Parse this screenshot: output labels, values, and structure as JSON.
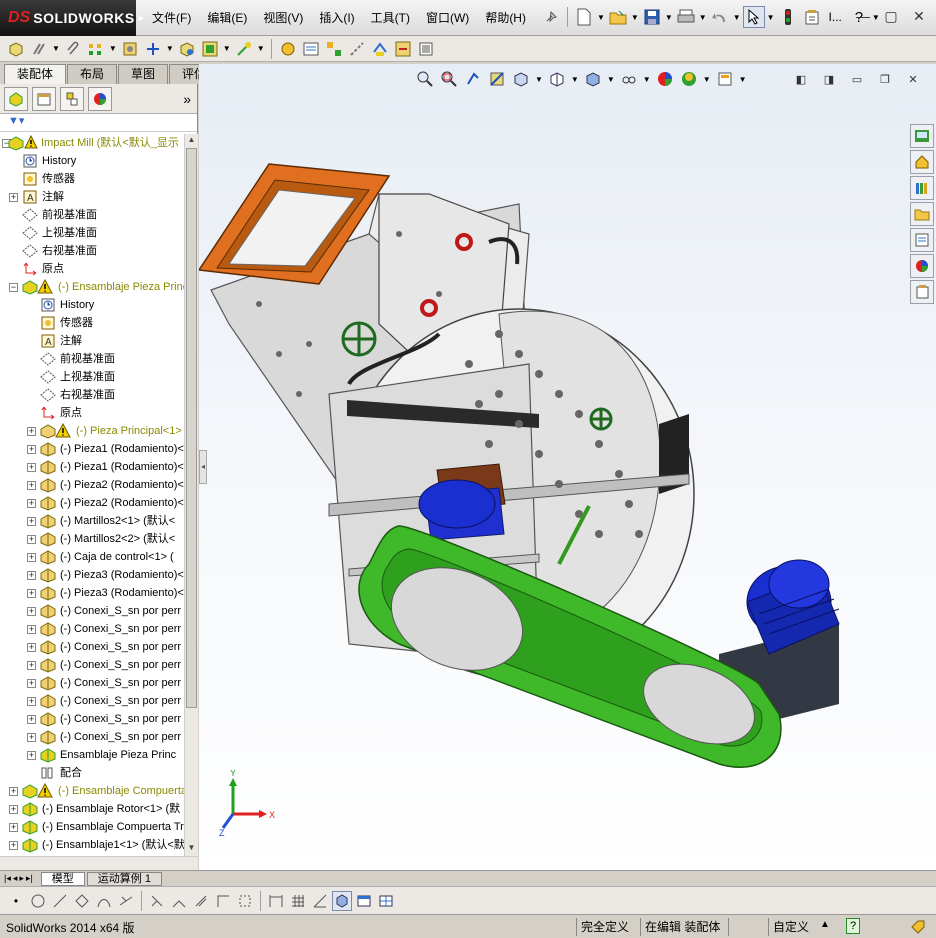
{
  "app": {
    "logo_ds": "DS",
    "logo_name": "SOLIDWORKS",
    "menu": [
      "文件(F)",
      "编辑(E)",
      "视图(V)",
      "插入(I)",
      "工具(T)",
      "窗口(W)",
      "帮助(H)"
    ],
    "window_truncated": "I..."
  },
  "command_tabs": [
    {
      "label": "装配体",
      "active": true
    },
    {
      "label": "布局",
      "active": false
    },
    {
      "label": "草图",
      "active": false
    },
    {
      "label": "评估",
      "active": false
    }
  ],
  "feature_tree": {
    "root_label": "Impact Mill  (默认<默认_显示",
    "rows": [
      {
        "level": 1,
        "expander": "",
        "icon": "history-icon",
        "label": "History",
        "warn": false
      },
      {
        "level": 1,
        "expander": "",
        "icon": "sensor-icon",
        "label": "传感器",
        "warn": false
      },
      {
        "level": 1,
        "expander": "+",
        "icon": "annotation-icon",
        "label": "注解",
        "warn": false
      },
      {
        "level": 1,
        "expander": "",
        "icon": "plane-icon",
        "label": "前视基准面",
        "warn": false
      },
      {
        "level": 1,
        "expander": "",
        "icon": "plane-icon",
        "label": "上视基准面",
        "warn": false
      },
      {
        "level": 1,
        "expander": "",
        "icon": "plane-icon",
        "label": "右视基准面",
        "warn": false
      },
      {
        "level": 1,
        "expander": "",
        "icon": "origin-icon",
        "label": "原点",
        "warn": false
      },
      {
        "level": 1,
        "expander": "-",
        "icon": "assembly-warning-icon",
        "label": "(-) Ensamblaje Pieza Princ",
        "warn": true
      },
      {
        "level": 2,
        "expander": "",
        "icon": "history-icon",
        "label": "History",
        "warn": false
      },
      {
        "level": 2,
        "expander": "",
        "icon": "sensor-icon",
        "label": "传感器",
        "warn": false
      },
      {
        "level": 2,
        "expander": "",
        "icon": "annotation-icon",
        "label": "注解",
        "warn": false
      },
      {
        "level": 2,
        "expander": "",
        "icon": "plane-icon",
        "label": "前视基准面",
        "warn": false
      },
      {
        "level": 2,
        "expander": "",
        "icon": "plane-icon",
        "label": "上视基准面",
        "warn": false
      },
      {
        "level": 2,
        "expander": "",
        "icon": "plane-icon",
        "label": "右视基准面",
        "warn": false
      },
      {
        "level": 2,
        "expander": "",
        "icon": "origin-icon",
        "label": "原点",
        "warn": false
      },
      {
        "level": 2,
        "expander": "+",
        "icon": "part-warning-icon",
        "label": "(-) Pieza Principal<1>",
        "warn": true
      },
      {
        "level": 2,
        "expander": "+",
        "icon": "part-icon",
        "label": "(-) Pieza1 (Rodamiento)<",
        "warn": false
      },
      {
        "level": 2,
        "expander": "+",
        "icon": "part-icon",
        "label": "(-) Pieza1 (Rodamiento)<",
        "warn": false
      },
      {
        "level": 2,
        "expander": "+",
        "icon": "part-icon",
        "label": "(-) Pieza2 (Rodamiento)<",
        "warn": false
      },
      {
        "level": 2,
        "expander": "+",
        "icon": "part-icon",
        "label": "(-) Pieza2 (Rodamiento)<",
        "warn": false
      },
      {
        "level": 2,
        "expander": "+",
        "icon": "part-icon",
        "label": "(-) Martillos2<1> (默认<",
        "warn": false
      },
      {
        "level": 2,
        "expander": "+",
        "icon": "part-icon",
        "label": "(-) Martillos2<2> (默认<",
        "warn": false
      },
      {
        "level": 2,
        "expander": "+",
        "icon": "part-icon",
        "label": "(-) Caja de control<1> (",
        "warn": false
      },
      {
        "level": 2,
        "expander": "+",
        "icon": "part-icon",
        "label": "(-) Pieza3 (Rodamiento)<",
        "warn": false
      },
      {
        "level": 2,
        "expander": "+",
        "icon": "part-icon",
        "label": "(-) Pieza3 (Rodamiento)<",
        "warn": false
      },
      {
        "level": 2,
        "expander": "+",
        "icon": "part-icon",
        "label": "(-) Conexi_S_sn por perr",
        "warn": false
      },
      {
        "level": 2,
        "expander": "+",
        "icon": "part-icon",
        "label": "(-) Conexi_S_sn por perr",
        "warn": false
      },
      {
        "level": 2,
        "expander": "+",
        "icon": "part-icon",
        "label": "(-) Conexi_S_sn por perr",
        "warn": false
      },
      {
        "level": 2,
        "expander": "+",
        "icon": "part-icon",
        "label": "(-) Conexi_S_sn por perr",
        "warn": false
      },
      {
        "level": 2,
        "expander": "+",
        "icon": "part-icon",
        "label": "(-) Conexi_S_sn por perr",
        "warn": false
      },
      {
        "level": 2,
        "expander": "+",
        "icon": "part-icon",
        "label": "(-) Conexi_S_sn por perr",
        "warn": false
      },
      {
        "level": 2,
        "expander": "+",
        "icon": "part-icon",
        "label": "(-) Conexi_S_sn por perr",
        "warn": false
      },
      {
        "level": 2,
        "expander": "+",
        "icon": "part-icon",
        "label": "(-) Conexi_S_sn por perr",
        "warn": false
      },
      {
        "level": 2,
        "expander": "+",
        "icon": "subassembly-icon",
        "label": "Ensamblaje Pieza Princ",
        "warn": false
      },
      {
        "level": 2,
        "expander": "",
        "icon": "mates-icon",
        "label": "配合",
        "warn": false
      },
      {
        "level": 1,
        "expander": "+",
        "icon": "assembly-warning-icon",
        "label": "(-) Ensamblaje Compuerta",
        "warn": true
      },
      {
        "level": 1,
        "expander": "+",
        "icon": "subassembly-icon",
        "label": "(-) Ensamblaje Rotor<1> (默",
        "warn": false
      },
      {
        "level": 1,
        "expander": "+",
        "icon": "subassembly-icon",
        "label": "(-) Ensamblaje Compuerta Tr",
        "warn": false
      },
      {
        "level": 1,
        "expander": "+",
        "icon": "subassembly-icon",
        "label": "(-) Ensamblaje1<1> (默认<默",
        "warn": false
      }
    ]
  },
  "bottom_tabs": [
    {
      "label": "模型",
      "active": true
    },
    {
      "label": "运动算例 1",
      "active": false
    }
  ],
  "status": {
    "app_version": "SolidWorks 2014 x64 版",
    "definition": "完全定义",
    "editing": "在编辑 装配体",
    "units": "自定义"
  },
  "triad": {
    "x": "X",
    "y": "Y",
    "z": "Z"
  },
  "colors": {
    "brand_red": "#e02020",
    "hopper_orange": "#e07020",
    "belt_guard_green": "#3fb82a",
    "motor_blue": "#1a2fd0",
    "warning_yellow": "#f0d000"
  }
}
